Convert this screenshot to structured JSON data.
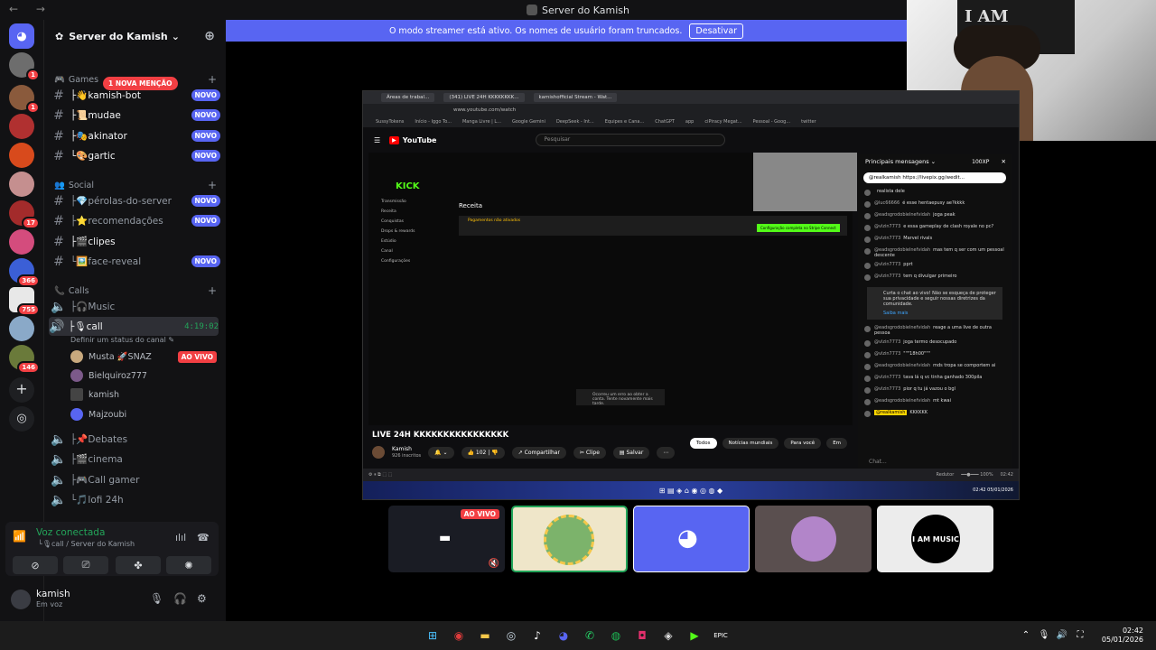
{
  "window": {
    "title": "Server do Kamish",
    "nav": "← →"
  },
  "colors": {
    "blurple": "#5865f2",
    "green": "#23a55a",
    "red": "#f23f43",
    "bg": "#121214"
  },
  "server_list": {
    "badges": [
      "1",
      "1",
      "17",
      "366",
      "755",
      "146"
    ]
  },
  "guild": {
    "name": "Server do Kamish",
    "chevron": "⌄",
    "invite_icon": "add-user-icon"
  },
  "banner": {
    "text": "O modo streamer está ativo. Os nomes de usuário foram truncados.",
    "button": "Desativar"
  },
  "mention_badge": "1 NOVA MENÇÃO",
  "categories": {
    "games": "Games",
    "social": "Social",
    "calls": "Calls",
    "add": "+"
  },
  "channels": [
    {
      "name": "├👋kamish-bot",
      "badge": "NOVO"
    },
    {
      "name": "├📜mudae",
      "badge": "NOVO"
    },
    {
      "name": "├🎭akinator",
      "badge": "NOVO"
    },
    {
      "name": "└🎨gartic",
      "badge": "NOVO"
    },
    {
      "name": "├💎pérolas-do-server",
      "badge": "NOVO"
    },
    {
      "name": "├⭐recomendações",
      "badge": "NOVO"
    },
    {
      "name": "├🎬clipes",
      "badge": ""
    },
    {
      "name": "└🖼️face-reveal",
      "badge": "NOVO"
    }
  ],
  "voice_channels": {
    "music": "├🎧Music",
    "call": "├🎙call",
    "call_timer": "4:19:02",
    "call_status": "Definir um status do canal ✎",
    "users": [
      {
        "name": "Musta 🚀SNAZ",
        "live": "AO VIVO"
      },
      {
        "name": "Bielquiroz777",
        "live": ""
      },
      {
        "name": "kamish",
        "live": ""
      },
      {
        "name": "Majzoubi",
        "live": ""
      }
    ],
    "others": [
      "├📌Debates",
      "├🎬cinema",
      "├🎮Call gamer",
      "└🎵lofi 24h"
    ]
  },
  "voice_panel": {
    "title": "Voz conectada",
    "subtitle": "└🎙call / Server do Kamish"
  },
  "user_panel": {
    "name": "kamish",
    "status": "Em voz"
  },
  "webcam": {
    "poster_text": "I AM MUSIC"
  },
  "browser": {
    "tabs": [
      "Áreas de trabal...",
      "(341) LIVE 24H KKKKKKKK...",
      "kamishofficial Stream - Wat..."
    ],
    "url": "www.youtube.com/watch",
    "bookmarks": [
      "SussyTokens",
      "Início - Iggo To...",
      "Manga Livre | L...",
      "Google Gemini",
      "DeepSeek - Int...",
      "Equipes e Cana...",
      "ChatGPT",
      "app",
      "ciPiracy Megat...",
      "Pessoal - Goog...",
      "twitter"
    ]
  },
  "youtube": {
    "search_placeholder": "Pesquisar",
    "video_title": "LIVE 24H KKKKKKKKKKKKKKKK",
    "channel": "Kamish",
    "subs": "926 inscritos",
    "likes": "102",
    "share": "Compartilhar",
    "clip": "Clipe",
    "save": "Salvar",
    "filters": [
      "Todos",
      "Notícias mundiais",
      "Para você",
      "Em"
    ]
  },
  "kick": {
    "logo": "KICK",
    "menu": [
      "Transmissão",
      "Receita",
      "Conquistas",
      "Drops & rewards",
      "Estúdio",
      "Canal",
      "Configurações"
    ],
    "title": "Receita",
    "warning": "Pagamentos não ativados",
    "button": "Configuração completa no Stripe Connect",
    "toast": "Ocorreu um erro ao obter a conta. Tente novamente mais tarde."
  },
  "chat": {
    "header": "Principais mensagens ⌄",
    "xp": "100XP",
    "pinned": "@realkamish  https://livepix.gg/wedit...",
    "messages": [
      {
        "user": "",
        "text": "realista dele"
      },
      {
        "user": "@luc66666",
        "text": "é esse hentaepusy ae?kkkk"
      },
      {
        "user": "@eadsgrodobielnefvidah",
        "text": "joga peak"
      },
      {
        "user": "@vlzin7773",
        "text": "e essa gameplay de clash royale no pc?"
      },
      {
        "user": "@vlzin7773",
        "text": "Marvel rivals"
      },
      {
        "user": "@eadsgrodobielnefvidah",
        "text": "mas tem q ser com um pessoal descente"
      },
      {
        "user": "@vlzin7773",
        "text": "pprt"
      },
      {
        "user": "@vlzin7773",
        "text": "tem q divulgar primeiro"
      }
    ],
    "notice": "Curta o chat ao vivo! Não se esqueça de proteger sua privacidade e seguir nossas diretrizes da comunidade.",
    "notice_link": "Saiba mais",
    "messages2": [
      {
        "user": "@eadsgrodobielnefvidah",
        "text": "reage a uma live de outra pessoa"
      },
      {
        "user": "@vlzin7773",
        "text": "joga termo desocupado"
      },
      {
        "user": "@vlzin7773",
        "text": "\"\"\"18h00\"\"\""
      },
      {
        "user": "@eadsgrodobielnefvidah",
        "text": "mds tropa se comportem ai"
      },
      {
        "user": "@vlzin7773",
        "text": "tava lá q vc tinha ganhado 300pila"
      },
      {
        "user": "@vlzin7773",
        "text": "pior q tu já vazou o bgl"
      },
      {
        "user": "@eadsgrodobielnefvidah",
        "text": "mt kwai"
      },
      {
        "user": "@realkamish",
        "text": "KKKKKK"
      }
    ],
    "input_placeholder": "Chat..."
  },
  "inner_taskbar": {
    "time": "02:42",
    "date": "05/01/2026",
    "controls": "Redutor"
  },
  "tiles": {
    "live": "AO VIVO",
    "music": "I AM MUSIC"
  },
  "taskbar": {
    "time": "02:42",
    "date": "05/01/2026"
  }
}
